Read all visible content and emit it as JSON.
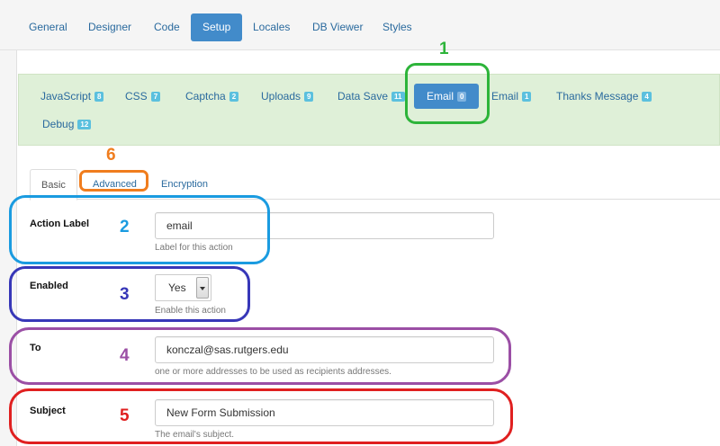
{
  "top_nav": {
    "tabs": [
      {
        "label": "General"
      },
      {
        "label": "Designer"
      },
      {
        "label": "Code"
      },
      {
        "label": "Setup"
      },
      {
        "label": "Locales"
      },
      {
        "label": "DB Viewer"
      },
      {
        "label": "Styles"
      }
    ],
    "active": "Setup"
  },
  "action_tabs": [
    {
      "label": "JavaScript",
      "badge": "8"
    },
    {
      "label": "CSS",
      "badge": "7"
    },
    {
      "label": "Captcha",
      "badge": "2"
    },
    {
      "label": "Uploads",
      "badge": "9"
    },
    {
      "label": "Data Save",
      "badge": "11"
    },
    {
      "label": "Email",
      "badge": "0"
    },
    {
      "label": "Email",
      "badge": "1"
    },
    {
      "label": "Thanks Message",
      "badge": "4"
    },
    {
      "label": "Debug",
      "badge": "12"
    }
  ],
  "inner_tabs": [
    {
      "label": "Basic"
    },
    {
      "label": "Advanced"
    },
    {
      "label": "Encryption"
    }
  ],
  "form": {
    "action_label": {
      "label": "Action Label",
      "value": "email",
      "help": "Label for this action"
    },
    "enabled": {
      "label": "Enabled",
      "value": "Yes",
      "help": "Enable this action"
    },
    "to": {
      "label": "To",
      "value": "konczal@sas.rutgers.edu",
      "help": "one or more addresses to be used as recipients addresses."
    },
    "subject": {
      "label": "Subject",
      "value": "New Form Submission",
      "help": "The email's subject."
    }
  },
  "annotations": [
    {
      "number": "1",
      "color": "#2db43a"
    },
    {
      "number": "2",
      "color": "#1a9be0"
    },
    {
      "number": "3",
      "color": "#3737b8"
    },
    {
      "number": "4",
      "color": "#9b4fa5"
    },
    {
      "number": "5",
      "color": "#e02020"
    },
    {
      "number": "6",
      "color": "#f07d1e"
    }
  ]
}
